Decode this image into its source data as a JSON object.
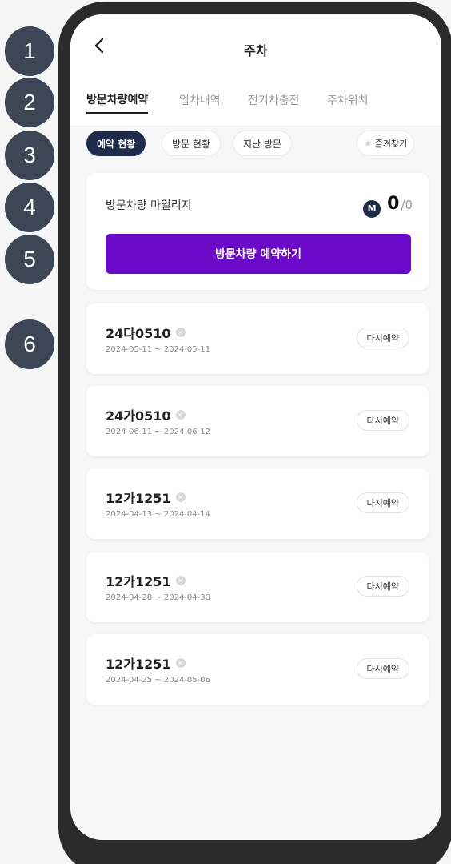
{
  "steps": [
    "1",
    "2",
    "3",
    "4",
    "5",
    "6"
  ],
  "header": {
    "title": "주차",
    "back_icon": "chevron-left-icon"
  },
  "tabs": [
    {
      "label": "방문차량예약",
      "active": true
    },
    {
      "label": "입차내역",
      "active": false
    },
    {
      "label": "전기차충전",
      "active": false
    },
    {
      "label": "주차위치",
      "active": false
    }
  ],
  "filters": [
    {
      "label": "예약 현황",
      "active": true
    },
    {
      "label": "방문 현황",
      "active": false
    },
    {
      "label": "지난 방문",
      "active": false
    }
  ],
  "favorites": {
    "label": "즐겨찾기",
    "icon": "star-icon"
  },
  "mileage": {
    "label": "방문차량 마일리지",
    "icon_letter": "M",
    "current": "0",
    "total": "/0"
  },
  "reserve_button": "방문차량 예약하기",
  "reservations": [
    {
      "plate": "24다0510",
      "dates": "2024-05-11 ~ 2024-05-11",
      "button": "다시예약"
    },
    {
      "plate": "24가0510",
      "dates": "2024-06-11 ~ 2024-06-12",
      "button": "다시예약"
    },
    {
      "plate": "12가1251",
      "dates": "2024-04-13 ~ 2024-04-14",
      "button": "다시예약"
    },
    {
      "plate": "12가1251",
      "dates": "2024-04-28 ~ 2024-04-30",
      "button": "다시예약"
    },
    {
      "plate": "12가1251",
      "dates": "2024-04-25 ~ 2024-05-06",
      "button": "다시예약"
    }
  ],
  "colors": {
    "accent": "#6b0ac9",
    "navy": "#1f2b4a",
    "marker": "#3c4654"
  }
}
